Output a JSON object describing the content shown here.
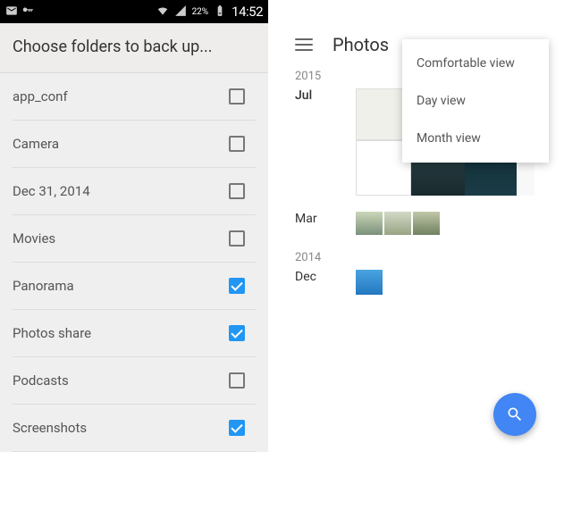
{
  "left": {
    "status": {
      "key_icon": "key-icon",
      "wifi": "wifi-icon",
      "signal": "cell-signal-icon",
      "battery_pct": "22%",
      "time": "14:52"
    },
    "header_title": "Choose folders to back up...",
    "folders": [
      {
        "label": "app_conf",
        "checked": false
      },
      {
        "label": "Camera",
        "checked": false
      },
      {
        "label": "Dec 31, 2014",
        "checked": false
      },
      {
        "label": "Movies",
        "checked": false
      },
      {
        "label": "Panorama",
        "checked": true
      },
      {
        "label": "Photos share",
        "checked": true
      },
      {
        "label": "Podcasts",
        "checked": false
      },
      {
        "label": "Screenshots",
        "checked": true
      }
    ]
  },
  "right": {
    "header_title": "Photos",
    "dropdown": [
      "Comfortable view",
      "Day view",
      "Month view"
    ],
    "sections": [
      {
        "year": "2015",
        "months": [
          {
            "label": "Jul",
            "bold": true,
            "thumbs": "large"
          },
          {
            "label": "Mar",
            "bold": false,
            "thumbs": "mar"
          }
        ]
      },
      {
        "year": "2014",
        "months": [
          {
            "label": "Dec",
            "bold": false,
            "thumbs": "dec"
          }
        ]
      }
    ],
    "fab_icon": "search-icon"
  }
}
